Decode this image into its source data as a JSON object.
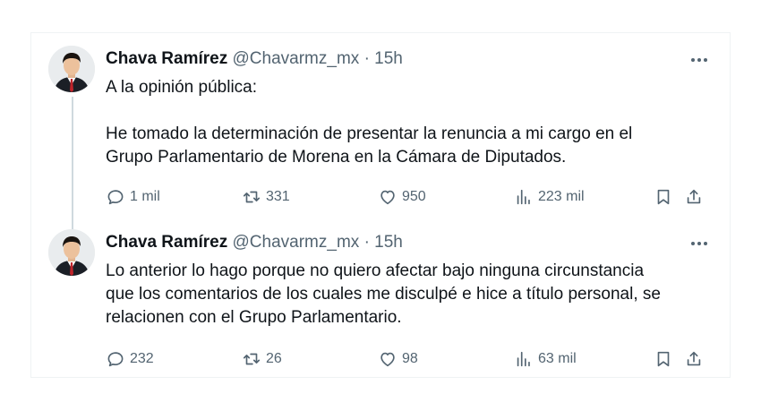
{
  "tweets": [
    {
      "display_name": "Chava Ramírez",
      "handle": "@Chavarmz_mx",
      "separator": "·",
      "time": "15h",
      "lines": [
        "A la opinión pública:",
        "He tomado la determinación de presentar la renuncia a mi cargo en el",
        "Grupo Parlamentario de Morena en la Cámara de Diputados."
      ],
      "replies": "1 mil",
      "retweets": "331",
      "likes": "950",
      "views": "223 mil"
    },
    {
      "display_name": "Chava Ramírez",
      "handle": "@Chavarmz_mx",
      "separator": "·",
      "time": "15h",
      "lines": [
        "Lo anterior lo hago porque no quiero afectar bajo ninguna circunstancia",
        "que los comentarios de los cuales me disculpé e hice a título personal, se",
        "relacionen con el Grupo Parlamentario."
      ],
      "replies": "232",
      "retweets": "26",
      "likes": "98",
      "views": "63 mil"
    }
  ],
  "colors": {
    "text": "#0f1419",
    "secondary": "#536471",
    "thread_line": "#cfd9de",
    "border": "#eff3f4",
    "tie": "#c0242b"
  },
  "icons": [
    "more-icon",
    "reply-icon",
    "retweet-icon",
    "like-icon",
    "views-icon",
    "bookmark-icon",
    "share-icon"
  ]
}
